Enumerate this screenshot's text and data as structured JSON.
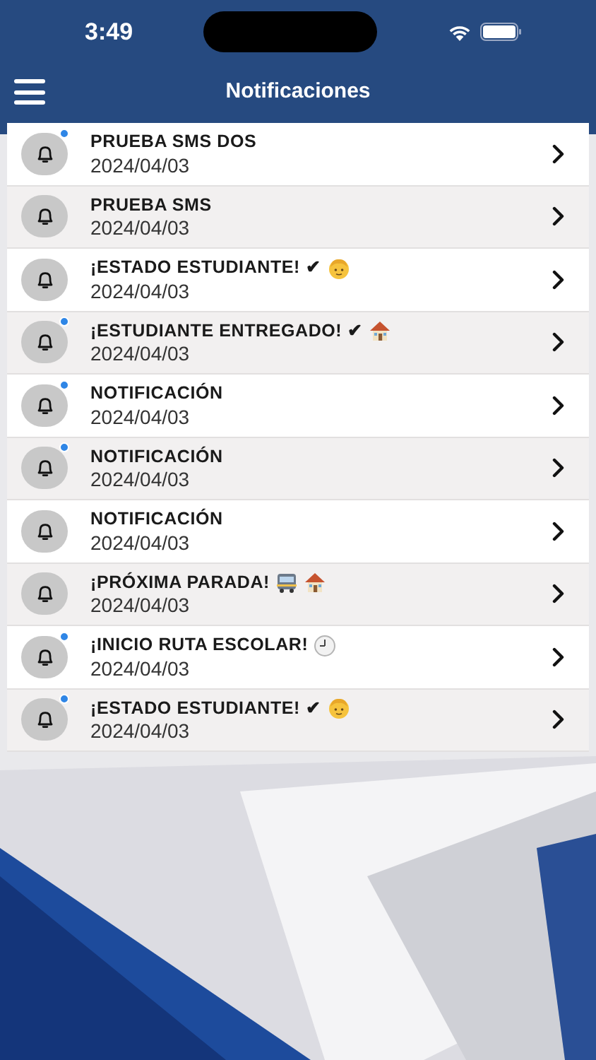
{
  "status_bar": {
    "time": "3:49"
  },
  "nav": {
    "title": "Notificaciones"
  },
  "notifications": [
    {
      "title": "PRUEBA SMS DOS",
      "date": "2024/04/03",
      "unread": true
    },
    {
      "title": "PRUEBA SMS",
      "date": "2024/04/03",
      "unread": false
    },
    {
      "title": "¡ESTADO ESTUDIANTE! ✔",
      "date": "2024/04/03",
      "unread": false,
      "emoji": [
        {
          "kind": "child"
        }
      ]
    },
    {
      "title": "¡ESTUDIANTE ENTREGADO! ✔",
      "date": "2024/04/03",
      "unread": true,
      "emoji": [
        {
          "kind": "house"
        }
      ]
    },
    {
      "title": "NOTIFICACIÓN",
      "date": "2024/04/03",
      "unread": true
    },
    {
      "title": "NOTIFICACIÓN",
      "date": "2024/04/03",
      "unread": true
    },
    {
      "title": "NOTIFICACIÓN",
      "date": "2024/04/03",
      "unread": false
    },
    {
      "title": "¡PRÓXIMA PARADA!",
      "date": "2024/04/03",
      "unread": false,
      "emoji": [
        {
          "kind": "bus"
        },
        {
          "kind": "house"
        }
      ]
    },
    {
      "title": "¡INICIO RUTA ESCOLAR!",
      "date": "2024/04/03",
      "unread": true,
      "emoji": [
        {
          "kind": "clock"
        }
      ]
    },
    {
      "title": "¡ESTADO ESTUDIANTE! ✔",
      "date": "2024/04/03",
      "unread": true,
      "emoji": [
        {
          "kind": "child"
        }
      ]
    }
  ]
}
